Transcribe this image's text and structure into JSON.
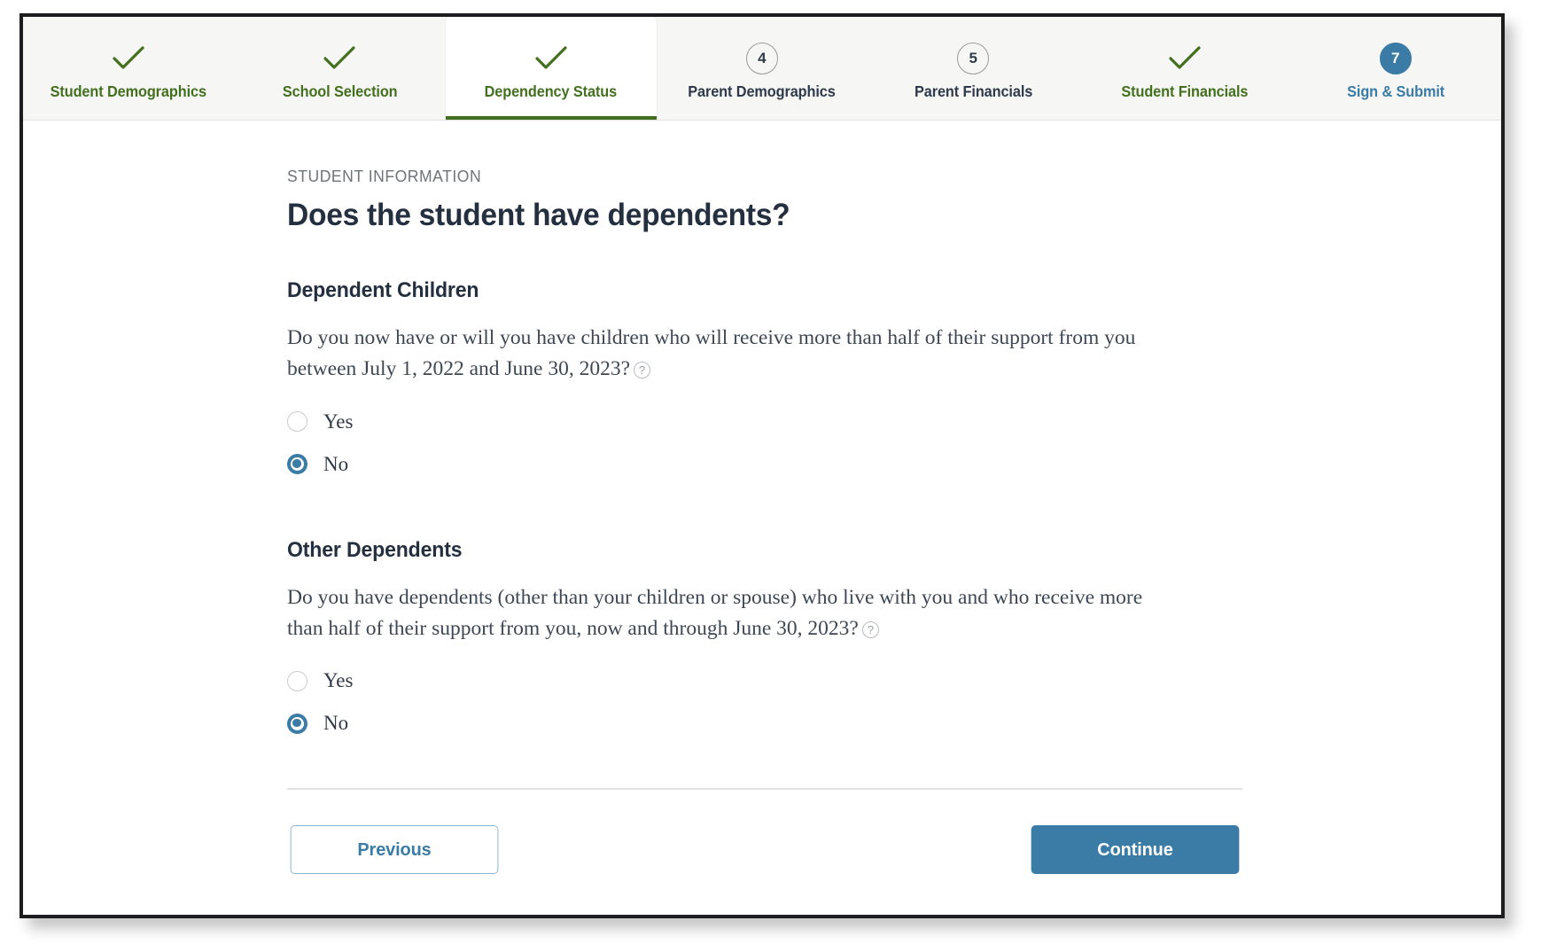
{
  "stepper": {
    "steps": [
      {
        "label": "Student Demographics",
        "marker": "check-icon",
        "state": "done",
        "number": ""
      },
      {
        "label": "School Selection",
        "marker": "check-icon",
        "state": "done",
        "number": ""
      },
      {
        "label": "Dependency Status",
        "marker": "check-icon",
        "state": "active",
        "number": ""
      },
      {
        "label": "Parent Demographics",
        "marker": "number",
        "state": "todo",
        "number": "4"
      },
      {
        "label": "Parent Financials",
        "marker": "number",
        "state": "todo",
        "number": "5"
      },
      {
        "label": "Student Financials",
        "marker": "check-icon",
        "state": "done",
        "number": ""
      },
      {
        "label": "Sign & Submit",
        "marker": "number-filled",
        "state": "current",
        "number": "7"
      }
    ]
  },
  "main": {
    "eyebrow": "STUDENT INFORMATION",
    "title": "Does the student have dependents?",
    "questions": [
      {
        "heading": "Dependent Children",
        "text": "Do you now have or will you have children who will receive more than half of their support from you between July 1, 2022 and June 30, 2023?",
        "help_icon": "help-circle-icon",
        "help_glyph": "?",
        "options": [
          {
            "label": "Yes",
            "selected": false
          },
          {
            "label": "No",
            "selected": true
          }
        ]
      },
      {
        "heading": "Other Dependents",
        "text": "Do you have dependents (other than your children or spouse) who live with you and who receive more than half of their support from you, now and through June 30, 2023?",
        "help_icon": "help-circle-icon",
        "help_glyph": "?",
        "options": [
          {
            "label": "Yes",
            "selected": false
          },
          {
            "label": "No",
            "selected": true
          }
        ]
      }
    ]
  },
  "footer": {
    "previous_label": "Previous",
    "continue_label": "Continue"
  },
  "colors": {
    "accent_blue": "#3a7ca5",
    "done_green": "#43701f",
    "heading_navy": "#24303f",
    "body_text": "#3d4854",
    "bar_background": "#f6f6f4"
  }
}
